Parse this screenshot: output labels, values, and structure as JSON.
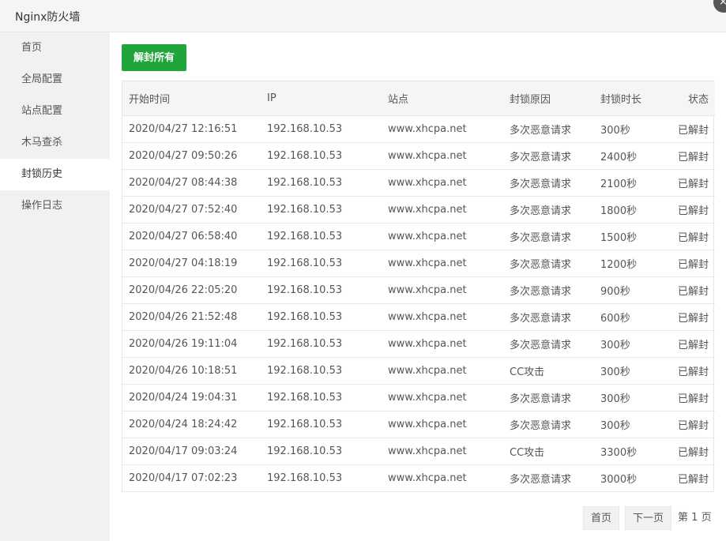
{
  "window": {
    "title": "Nginx防火墙",
    "close_glyph": "×"
  },
  "sidebar": {
    "items": [
      {
        "label": "首页"
      },
      {
        "label": "全局配置"
      },
      {
        "label": "站点配置"
      },
      {
        "label": "木马查杀"
      },
      {
        "label": "封锁历史",
        "active": true
      },
      {
        "label": "操作日志"
      }
    ]
  },
  "toolbar": {
    "unblock_all_label": "解封所有"
  },
  "table": {
    "headers": {
      "start_time": "开始时间",
      "ip": "IP",
      "site": "站点",
      "reason": "封锁原因",
      "duration": "封锁时长",
      "status": "状态"
    },
    "rows": [
      {
        "start_time": "2020/04/27 12:16:51",
        "ip": "192.168.10.53",
        "site": "www.xhcpa.net",
        "reason": "多次恶意请求",
        "duration": "300秒",
        "status": "已解封"
      },
      {
        "start_time": "2020/04/27 09:50:26",
        "ip": "192.168.10.53",
        "site": "www.xhcpa.net",
        "reason": "多次恶意请求",
        "duration": "2400秒",
        "status": "已解封"
      },
      {
        "start_time": "2020/04/27 08:44:38",
        "ip": "192.168.10.53",
        "site": "www.xhcpa.net",
        "reason": "多次恶意请求",
        "duration": "2100秒",
        "status": "已解封"
      },
      {
        "start_time": "2020/04/27 07:52:40",
        "ip": "192.168.10.53",
        "site": "www.xhcpa.net",
        "reason": "多次恶意请求",
        "duration": "1800秒",
        "status": "已解封"
      },
      {
        "start_time": "2020/04/27 06:58:40",
        "ip": "192.168.10.53",
        "site": "www.xhcpa.net",
        "reason": "多次恶意请求",
        "duration": "1500秒",
        "status": "已解封"
      },
      {
        "start_time": "2020/04/27 04:18:19",
        "ip": "192.168.10.53",
        "site": "www.xhcpa.net",
        "reason": "多次恶意请求",
        "duration": "1200秒",
        "status": "已解封"
      },
      {
        "start_time": "2020/04/26 22:05:20",
        "ip": "192.168.10.53",
        "site": "www.xhcpa.net",
        "reason": "多次恶意请求",
        "duration": "900秒",
        "status": "已解封"
      },
      {
        "start_time": "2020/04/26 21:52:48",
        "ip": "192.168.10.53",
        "site": "www.xhcpa.net",
        "reason": "多次恶意请求",
        "duration": "600秒",
        "status": "已解封"
      },
      {
        "start_time": "2020/04/26 19:11:04",
        "ip": "192.168.10.53",
        "site": "www.xhcpa.net",
        "reason": "多次恶意请求",
        "duration": "300秒",
        "status": "已解封"
      },
      {
        "start_time": "2020/04/26 10:18:51",
        "ip": "192.168.10.53",
        "site": "www.xhcpa.net",
        "reason": "CC攻击",
        "duration": "300秒",
        "status": "已解封"
      },
      {
        "start_time": "2020/04/24 19:04:31",
        "ip": "192.168.10.53",
        "site": "www.xhcpa.net",
        "reason": "多次恶意请求",
        "duration": "300秒",
        "status": "已解封"
      },
      {
        "start_time": "2020/04/24 18:24:42",
        "ip": "192.168.10.53",
        "site": "www.xhcpa.net",
        "reason": "多次恶意请求",
        "duration": "300秒",
        "status": "已解封"
      },
      {
        "start_time": "2020/04/17 09:03:24",
        "ip": "192.168.10.53",
        "site": "www.xhcpa.net",
        "reason": "CC攻击",
        "duration": "3300秒",
        "status": "已解封"
      },
      {
        "start_time": "2020/04/17 07:02:23",
        "ip": "192.168.10.53",
        "site": "www.xhcpa.net",
        "reason": "多次恶意请求",
        "duration": "3000秒",
        "status": "已解封"
      }
    ]
  },
  "pagination": {
    "first_label": "首页",
    "next_label": "下一页",
    "page_prefix": "第",
    "current_page": "1",
    "page_suffix": "页"
  },
  "colors": {
    "accent_green": "#20a53a",
    "sidebar_bg": "#f1f1f1",
    "header_bg": "#f5f5f5"
  }
}
